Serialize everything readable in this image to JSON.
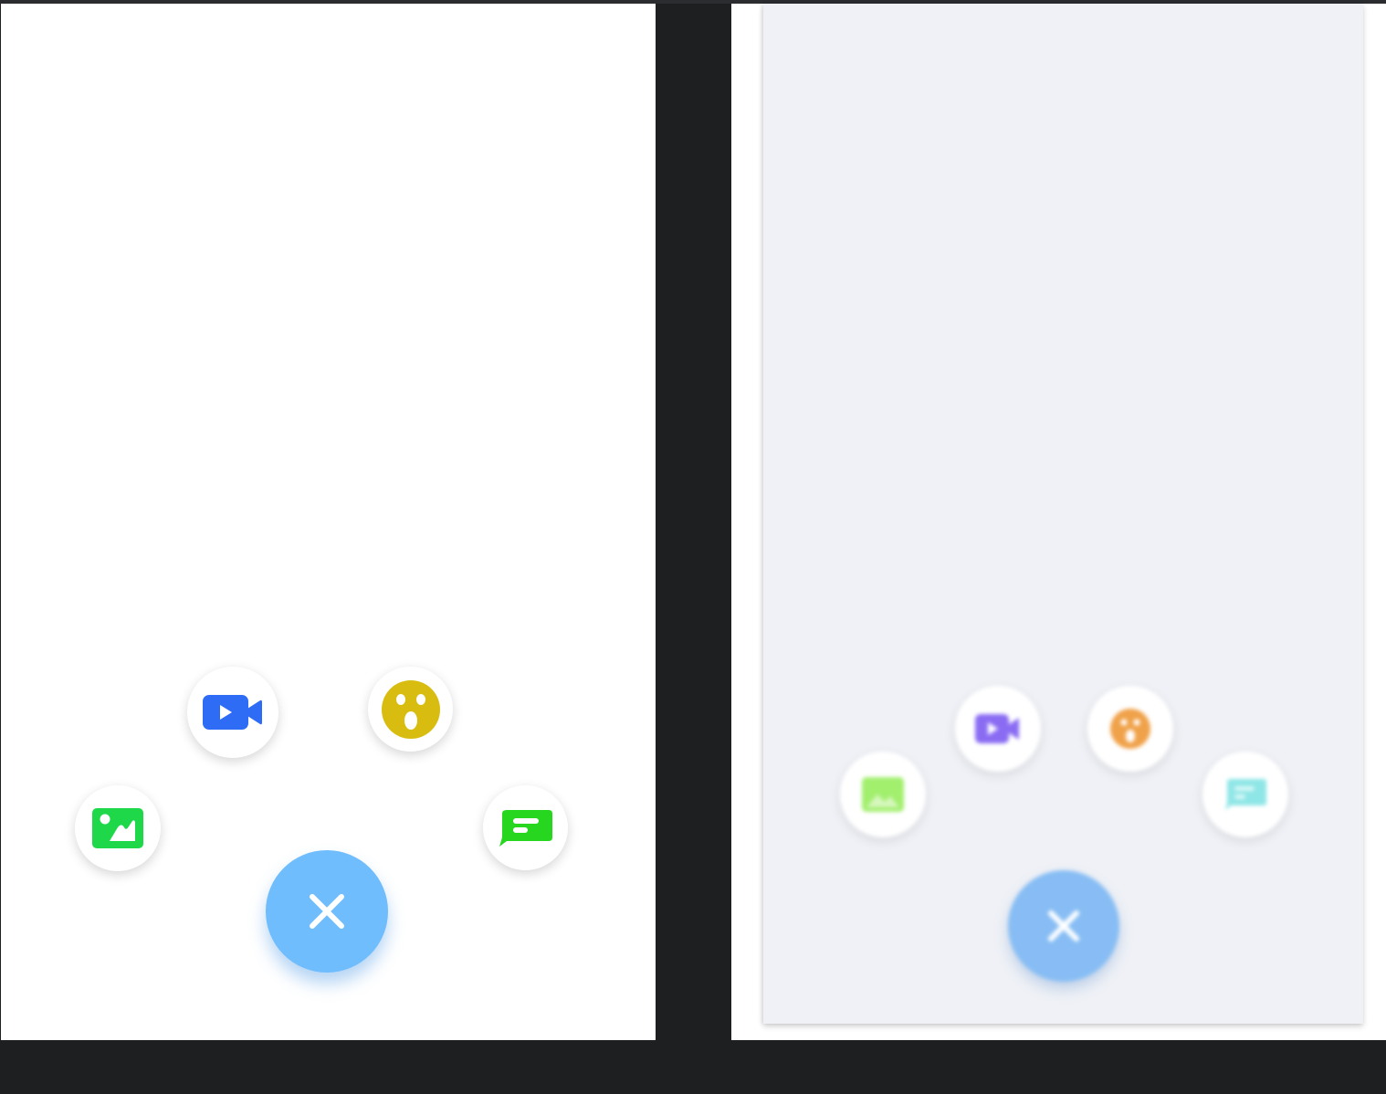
{
  "colors": {
    "background": "#1e1f21",
    "panel_left_bg": "#ffffff",
    "panel_right_bg": "#eff1f6",
    "fab_left": "#6fbdfd",
    "fab_right": "#87bdf4"
  },
  "left_menu": {
    "state": "expanded",
    "items": [
      {
        "icon": "image-icon",
        "color": "#1ed84a"
      },
      {
        "icon": "video-camera-icon",
        "color": "#2f6cf6"
      },
      {
        "icon": "surprised-face-icon",
        "color": "#d8bd10"
      },
      {
        "icon": "chat-bubble-icon",
        "color": "#27d61e"
      }
    ],
    "fab_icon": "close-icon"
  },
  "right_menu": {
    "state": "expanded-blurred",
    "items": [
      {
        "icon": "image-icon",
        "color": "#a2ef6e"
      },
      {
        "icon": "video-camera-icon",
        "color": "#8a6cf3"
      },
      {
        "icon": "surprised-face-icon",
        "color": "#f0a24a"
      },
      {
        "icon": "chat-bubble-icon",
        "color": "#8fe6e6"
      }
    ],
    "fab_icon": "close-icon"
  }
}
